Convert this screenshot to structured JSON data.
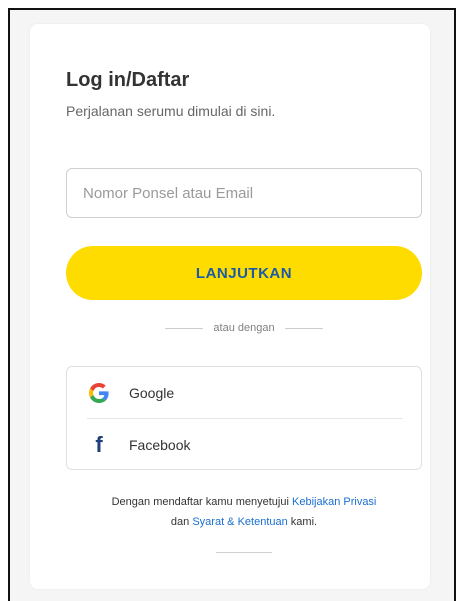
{
  "login": {
    "title": "Log in/Daftar",
    "subtitle": "Perjalanan serumu dimulai di sini.",
    "input_placeholder": "Nomor Ponsel atau Email",
    "input_value": "",
    "continue_label": "LANJUTKAN",
    "divider_text": "atau dengan"
  },
  "social": {
    "google_label": "Google",
    "facebook_label": "Facebook"
  },
  "terms": {
    "prefix": "Dengan mendaftar kamu menyetujui ",
    "privacy_link": "Kebijakan Privasi",
    "middle": "dan ",
    "terms_link": "Syarat & Ketentuan",
    "suffix": " kami."
  },
  "colors": {
    "accent_yellow": "#ffdc00",
    "button_text_blue": "#1a5aa8",
    "link_blue": "#1a6fd0",
    "facebook_blue": "#1f3f7a"
  },
  "icons": {
    "google": "google-logo-icon",
    "facebook": "facebook-logo-icon"
  }
}
